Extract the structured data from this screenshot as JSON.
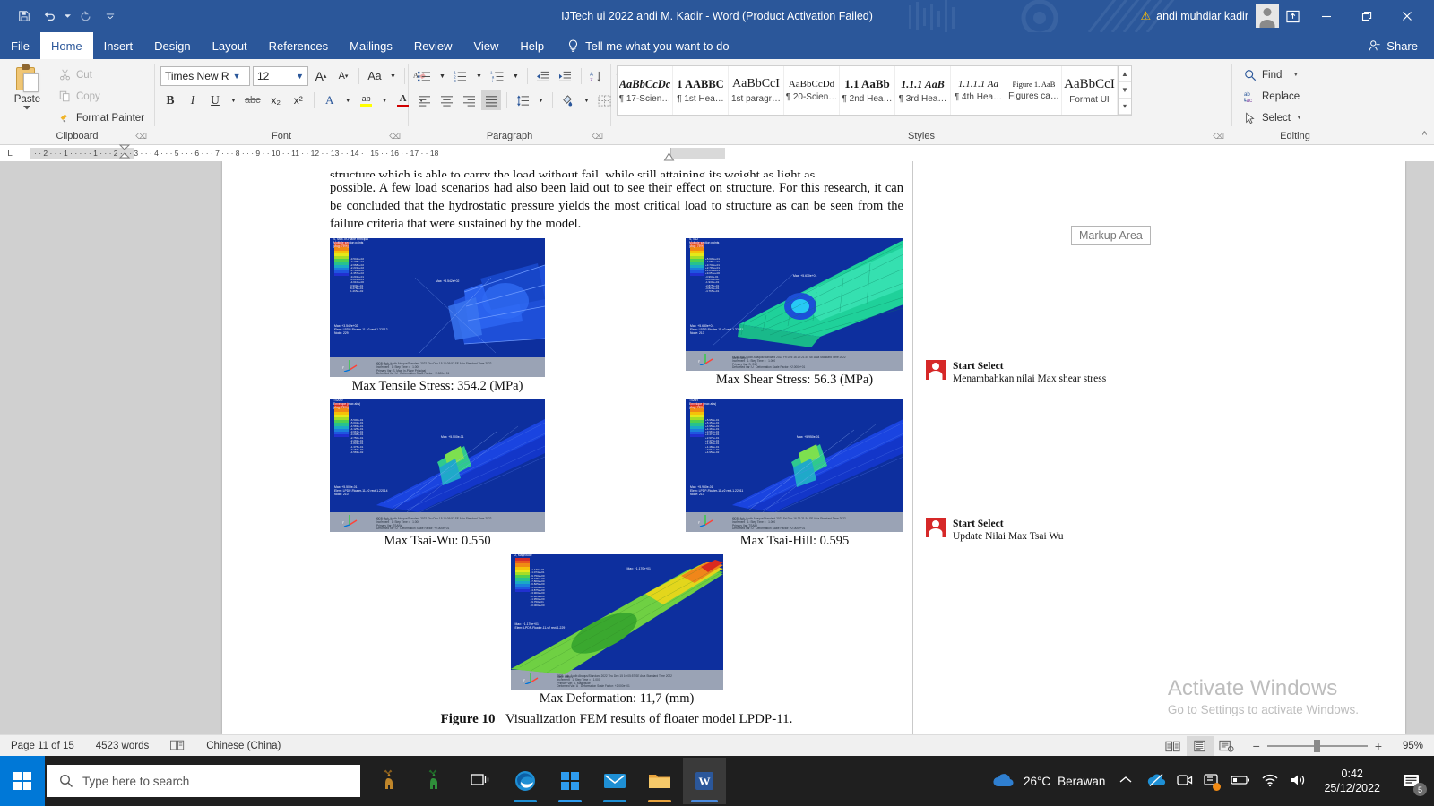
{
  "titlebar": {
    "document_title": "IJTech  ui 2022 andi M. Kadir  -  Word (Product Activation Failed)",
    "account_name": "andi muhdiar kadir",
    "save_icon": "save-icon",
    "undo_icon": "undo-icon",
    "redo_icon": "redo-icon",
    "customize_icon": "chevron-down-icon",
    "warning_icon": "warning-triangle-icon",
    "ribbon_display_icon": "ribbon-display-options-icon",
    "minimize_icon": "minimize-icon",
    "restore_icon": "restore-icon",
    "close_icon": "close-icon"
  },
  "menubar": {
    "items": [
      {
        "label": "File",
        "active": false
      },
      {
        "label": "Home",
        "active": true
      },
      {
        "label": "Insert",
        "active": false
      },
      {
        "label": "Design",
        "active": false
      },
      {
        "label": "Layout",
        "active": false
      },
      {
        "label": "References",
        "active": false
      },
      {
        "label": "Mailings",
        "active": false
      },
      {
        "label": "Review",
        "active": false
      },
      {
        "label": "View",
        "active": false
      },
      {
        "label": "Help",
        "active": false
      }
    ],
    "tell_me": "Tell me what you want to do",
    "share": "Share"
  },
  "ribbon": {
    "clipboard": {
      "group_label": "Clipboard",
      "paste": "Paste",
      "cut": "Cut",
      "copy": "Copy",
      "format_painter": "Format Painter"
    },
    "font": {
      "group_label": "Font",
      "font_name": "Times New R",
      "font_size": "12",
      "grow_font": "A",
      "shrink_font": "A",
      "change_case": "Aa",
      "clear_formatting": "A",
      "bold": "B",
      "italic": "I",
      "underline": "U",
      "strikethrough": "abc",
      "subscript": "x₂",
      "superscript": "x²",
      "text_effects": "A",
      "highlight": "ab",
      "font_color": "A"
    },
    "paragraph": {
      "group_label": "Paragraph",
      "bullets": "bullets-icon",
      "numbering": "numbering-icon",
      "multilevel": "multilevel-list-icon",
      "decrease_indent": "decrease-indent-icon",
      "increase_indent": "increase-indent-icon",
      "sort": "sort-icon",
      "show_marks": "¶",
      "align_left": "align-left-icon",
      "align_center": "align-center-icon",
      "align_right": "align-right-icon",
      "justify": "justify-icon",
      "line_spacing": "line-spacing-icon",
      "shading": "shading-icon",
      "borders": "borders-icon"
    },
    "styles": {
      "group_label": "Styles",
      "items": [
        {
          "preview": "AaBbCcDc",
          "name": "¶ 17-Scien…"
        },
        {
          "preview": "1  AABBC",
          "name": "¶ 1st Hea…"
        },
        {
          "preview": "AaBbCcI",
          "name": "1st paragr…"
        },
        {
          "preview": "AaBbCcDd",
          "name": "¶ 20-Scien…"
        },
        {
          "preview": "1.1  AaBb",
          "name": "¶ 2nd Hea…"
        },
        {
          "preview": "1.1.1  AaB",
          "name": "¶ 3rd Hea…"
        },
        {
          "preview": "1.1.1.1  Aa",
          "name": "¶ 4th Hea…"
        },
        {
          "preview": "Figure 1.  AaB",
          "name": "Figures ca…"
        },
        {
          "preview": "AaBbCcI",
          "name": "Format UI"
        }
      ]
    },
    "editing": {
      "group_label": "Editing",
      "find": "Find",
      "replace": "Replace",
      "select": "Select"
    }
  },
  "ruler": {
    "marks": "·  ·  2  ·  ·  ·  1  ·  ·  ·        ·  ·  1  ·  ·  ·  2  ·  ·  ·  3  ·  ·  ·  4  ·  ·  ·  5  ·  ·  ·  6  ·  ·  ·  7  ·  ·  ·  8  ·  ·  ·  9  ·  ·  10  ·  ·  11  ·  ·  12  ·  ·  13  ·  ·  14  ·  ·  15  ·  ·  16  ·  ·  17  ·  ·  18"
  },
  "document": {
    "paragraph_line1": "structure which is able to carry the load without fail, while still attaining its weight as light as",
    "paragraph_rest": "possible. A few load scenarios had also been laid out to see their effect on structure. For this research, it can be concluded that the hydrostatic pressure yields the most critical load to structure as can be seen from the failure criteria that were sustained by the model.",
    "figures": [
      {
        "caption": "Max Tensile Stress: 354.2 (MPa)",
        "legend_title": "S, Max. In-Plane Principal",
        "sub_title": "Multiple section points",
        "unit": "(Avg: 75%)"
      },
      {
        "caption": "Max Shear Stress: 56.3 (MPa)",
        "legend_title": "S, S12",
        "sub_title": "Multiple section points",
        "unit": "(Avg: 75%)"
      },
      {
        "caption": "Max Tsai-Wu: 0.550",
        "legend_title": "TSAIW",
        "sub_title": "Envelope (max abs)",
        "unit": "(Avg: 75%)"
      },
      {
        "caption": "Max Tsai-Hill: 0.595",
        "legend_title": "TSAIH",
        "sub_title": "Envelope (max abs)",
        "unit": "(Avg: 75%)"
      },
      {
        "caption": "Max Deformation: 11,7 (mm)",
        "legend_title": "U, Magnitude",
        "sub_title": "",
        "unit": ""
      }
    ],
    "figure_caption_label": "Figure 10",
    "figure_caption_text": "Visualization FEM results of floater model LPDP-11."
  },
  "markup": {
    "markup_area_label": "Markup Area",
    "comments": [
      {
        "author": "Start Select",
        "text": "Menambahkan nilai Max shear stress"
      },
      {
        "author": "Start Select",
        "text": "Update Nilai Max Tsai Wu"
      }
    ]
  },
  "watermark": {
    "line1": "Activate Windows",
    "line2": "Go to Settings to activate Windows."
  },
  "statusbar": {
    "page": "Page 11 of 15",
    "words": "4523 words",
    "proofing_icon": "proofing-errors-icon",
    "language": "Chinese (China)",
    "view_read": "read-mode-icon",
    "view_print": "print-layout-icon",
    "view_web": "web-layout-icon",
    "zoom_out": "−",
    "zoom_in": "+",
    "zoom_level": "95%"
  },
  "taskbar": {
    "start_icon": "windows-start-icon",
    "search_placeholder": "Type here to search",
    "search_icon": "search-icon",
    "apps": [
      {
        "name": "task-view-icon",
        "accent": "#ffffff"
      },
      {
        "name": "edge-icon",
        "accent": "#0e7bc4"
      },
      {
        "name": "microsoft-store-icon",
        "accent": "#0e7bc4"
      },
      {
        "name": "mail-icon",
        "accent": "#0e7bc4"
      },
      {
        "name": "file-explorer-icon",
        "accent": "#e8a33d"
      },
      {
        "name": "word-icon",
        "accent": "#2b579a"
      }
    ],
    "weather_temp": "26°C",
    "weather_desc": "Berawan",
    "tray_icons": [
      "show-hidden-icons-chevron",
      "onedrive-icon",
      "camera-icon",
      "screen-icon",
      "battery-icon",
      "wifi-icon",
      "volume-icon"
    ],
    "clock_time": "0:42",
    "clock_date": "25/12/2022",
    "notification_count": "5"
  },
  "colors": {
    "word_blue": "#2b579a",
    "comment_red": "#d62828",
    "accent_orange": "#ffc000"
  }
}
